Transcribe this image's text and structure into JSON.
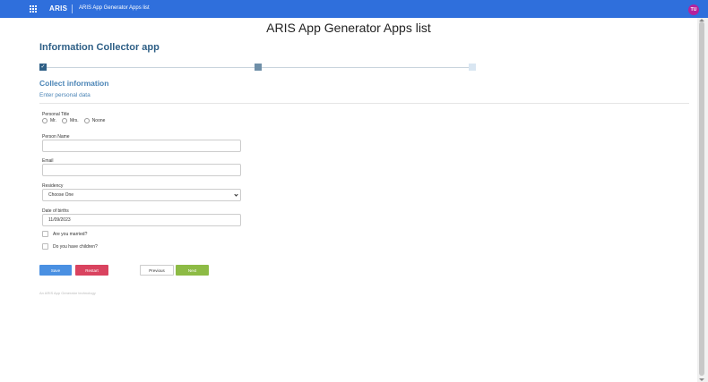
{
  "topbar": {
    "brand": "ARIS",
    "nav_title": "ARIS App Generator Apps list",
    "avatar_initials": "TU",
    "bg_color": "#2f6fdc",
    "avatar_color": "#b5219c"
  },
  "page": {
    "title": "ARIS App Generator Apps list",
    "app_title": "Information Collector app"
  },
  "stepper": {
    "steps": [
      {
        "status": "completed",
        "icon": "check-icon"
      },
      {
        "status": "current"
      },
      {
        "status": "upcoming"
      }
    ]
  },
  "section": {
    "title": "Collect information",
    "subtitle": "Enter personal data"
  },
  "form": {
    "personal_title": {
      "label": "Personal Title",
      "options": [
        "Mr.",
        "Mrs.",
        "Noone"
      ]
    },
    "person_name": {
      "label": "Person Name",
      "value": ""
    },
    "email": {
      "label": "Email",
      "value": ""
    },
    "residency": {
      "label": "Residency",
      "selected": "Choose One"
    },
    "date_of_births": {
      "label": "Date of births",
      "value": "11/09/2023"
    },
    "married": {
      "label": "Are you married?",
      "checked": false
    },
    "children": {
      "label": "Do you have children?",
      "checked": false
    }
  },
  "buttons": {
    "save": "Save",
    "restart": "Restart",
    "previous": "Previous",
    "next": "Next"
  },
  "footer": {
    "note": "An ARIS App Generator technology"
  }
}
